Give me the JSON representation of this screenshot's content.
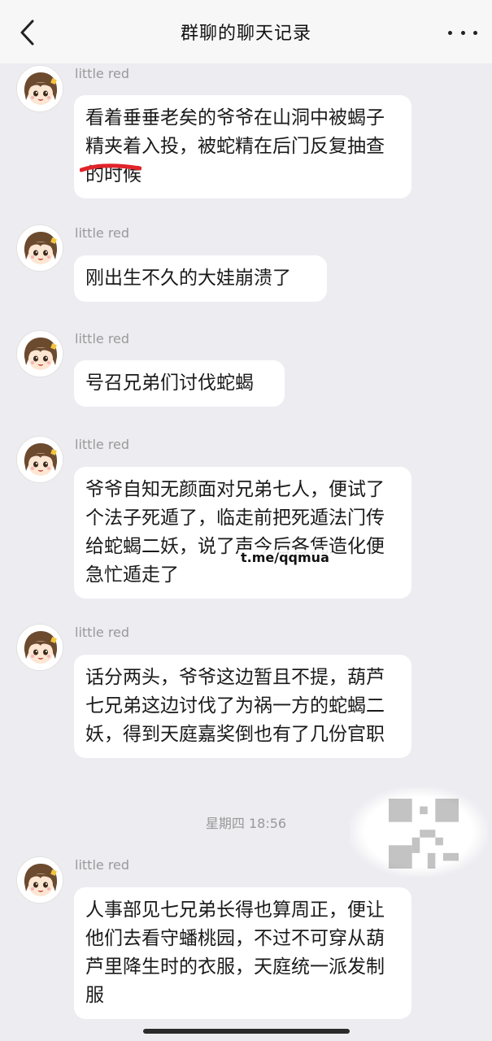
{
  "header": {
    "title": "群聊的聊天记录",
    "back_icon": "chevron-left-icon",
    "more_icon": "more-horizontal-icon"
  },
  "messages": [
    {
      "sender": "little red",
      "text": "看着垂垂老矣的爷爷在山洞中被蝎子精夹着入投，被蛇精在后门反复抽查的时候"
    },
    {
      "sender": "little red",
      "text": "刚出生不久的大娃崩溃了"
    },
    {
      "sender": "little red",
      "text": "号召兄弟们讨伐蛇蝎"
    },
    {
      "sender": "little red",
      "text": "爷爷自知无颜面对兄弟七人，便试了个法子死遁了，临走前把死遁法门传给蛇蝎二妖，说了声今后各凭造化便急忙遁走了"
    },
    {
      "sender": "little red",
      "text": "话分两头，爷爷这边暂且不提，葫芦七兄弟这边讨伐了为祸一方的蛇蝎二妖，得到天庭嘉奖倒也有了几份官职"
    },
    {
      "sender": "little red",
      "text": "人事部见七兄弟长得也算周正，便让他们去看守蟠桃园，不过不可穿从葫芦里降生时的衣服，天庭统一派发制服"
    }
  ],
  "timestamp": "星期四 18:56",
  "watermark": "t.me/qqmua",
  "colors": {
    "background": "#ececf1",
    "bubble": "#ffffff",
    "topbar": "#f7f7f7",
    "sender": "#9a9a9a",
    "redmark": "#e0242a"
  }
}
